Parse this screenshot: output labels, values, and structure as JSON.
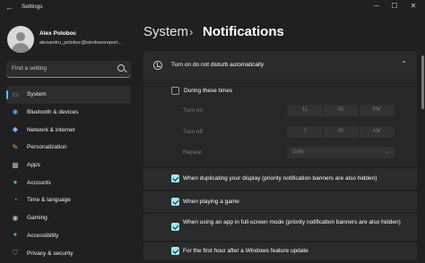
{
  "window": {
    "title": "Settings",
    "back_glyph": "←",
    "minimize_glyph": "─",
    "maximize_glyph": "☐",
    "close_glyph": "✕"
  },
  "profile": {
    "name": "Alex Poloboc",
    "email": "alexandru_poloboc@windowsreport..."
  },
  "search": {
    "placeholder": "Find a setting"
  },
  "nav": {
    "items": [
      {
        "label": "System",
        "icon": "system-icon",
        "glyph": "▭",
        "color": "#4cc2ff",
        "active": true
      },
      {
        "label": "Bluetooth & devices",
        "icon": "bluetooth-icon",
        "glyph": "✱",
        "color": "#4aa8ff",
        "active": false
      },
      {
        "label": "Network & internet",
        "icon": "network-icon",
        "glyph": "◆",
        "color": "#7fb3ff",
        "active": false
      },
      {
        "label": "Personalization",
        "icon": "personalization-icon",
        "glyph": "✎",
        "color": "#f0a35e",
        "active": false
      },
      {
        "label": "Apps",
        "icon": "apps-icon",
        "glyph": "▦",
        "color": "#b0b0c8",
        "active": false
      },
      {
        "label": "Accounts",
        "icon": "accounts-icon",
        "glyph": "●",
        "color": "#3fc28a",
        "active": false
      },
      {
        "label": "Time & language",
        "icon": "time-language-icon",
        "glyph": "◔",
        "color": "#4aa8ff",
        "active": false
      },
      {
        "label": "Gaming",
        "icon": "gaming-icon",
        "glyph": "◉",
        "color": "#b8b8b8",
        "active": false
      },
      {
        "label": "Accessibility",
        "icon": "accessibility-icon",
        "glyph": "✦",
        "color": "#4aa8ff",
        "active": false
      },
      {
        "label": "Privacy & security",
        "icon": "privacy-shield-icon",
        "glyph": "⛉",
        "color": "#8a8a8a",
        "active": false
      }
    ]
  },
  "header": {
    "parent": "System",
    "separator": "›",
    "current": "Notifications"
  },
  "dnd": {
    "label": "Turn on do not disturb automatically",
    "chevron": "⌃"
  },
  "schedule": {
    "during_label": "During these times",
    "during_checked": false,
    "turn_on_label": "Turn on",
    "turn_on": {
      "hour": "11",
      "minute": "00",
      "period": "PM"
    },
    "turn_off_label": "Turn off",
    "turn_off": {
      "hour": "7",
      "minute": "00",
      "period": "AM"
    },
    "repeat_label": "Repeat",
    "repeat_value": "Daily",
    "repeat_chevron": "⌄"
  },
  "options": [
    {
      "label": "When duplicating your display (priority notification banners are also hidden)",
      "checked": true
    },
    {
      "label": "When playing a game",
      "checked": true
    },
    {
      "label": "When using an app in full-screen mode (priority notification banners are also hidden)",
      "checked": true
    },
    {
      "label": "For the first hour after a Windows feature update",
      "checked": true
    }
  ]
}
